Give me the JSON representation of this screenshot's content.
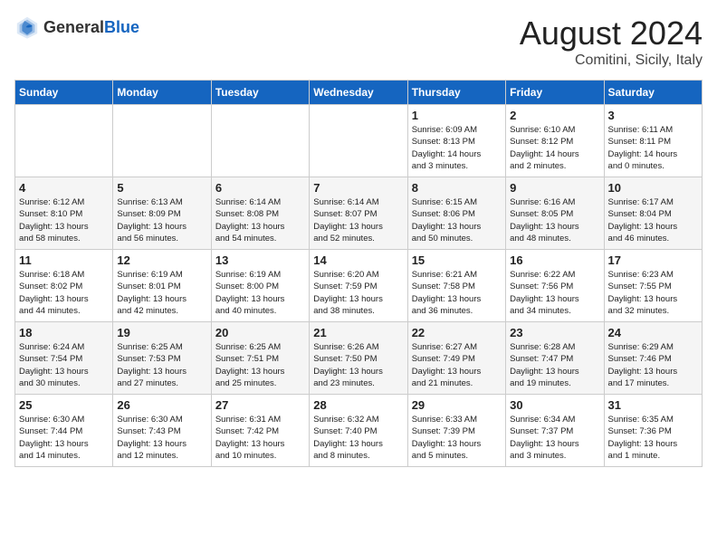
{
  "logo": {
    "general": "General",
    "blue": "Blue"
  },
  "header": {
    "month": "August 2024",
    "location": "Comitini, Sicily, Italy"
  },
  "days_of_week": [
    "Sunday",
    "Monday",
    "Tuesday",
    "Wednesday",
    "Thursday",
    "Friday",
    "Saturday"
  ],
  "weeks": [
    [
      {
        "day": "",
        "info": ""
      },
      {
        "day": "",
        "info": ""
      },
      {
        "day": "",
        "info": ""
      },
      {
        "day": "",
        "info": ""
      },
      {
        "day": "1",
        "info": "Sunrise: 6:09 AM\nSunset: 8:13 PM\nDaylight: 14 hours\nand 3 minutes."
      },
      {
        "day": "2",
        "info": "Sunrise: 6:10 AM\nSunset: 8:12 PM\nDaylight: 14 hours\nand 2 minutes."
      },
      {
        "day": "3",
        "info": "Sunrise: 6:11 AM\nSunset: 8:11 PM\nDaylight: 14 hours\nand 0 minutes."
      }
    ],
    [
      {
        "day": "4",
        "info": "Sunrise: 6:12 AM\nSunset: 8:10 PM\nDaylight: 13 hours\nand 58 minutes."
      },
      {
        "day": "5",
        "info": "Sunrise: 6:13 AM\nSunset: 8:09 PM\nDaylight: 13 hours\nand 56 minutes."
      },
      {
        "day": "6",
        "info": "Sunrise: 6:14 AM\nSunset: 8:08 PM\nDaylight: 13 hours\nand 54 minutes."
      },
      {
        "day": "7",
        "info": "Sunrise: 6:14 AM\nSunset: 8:07 PM\nDaylight: 13 hours\nand 52 minutes."
      },
      {
        "day": "8",
        "info": "Sunrise: 6:15 AM\nSunset: 8:06 PM\nDaylight: 13 hours\nand 50 minutes."
      },
      {
        "day": "9",
        "info": "Sunrise: 6:16 AM\nSunset: 8:05 PM\nDaylight: 13 hours\nand 48 minutes."
      },
      {
        "day": "10",
        "info": "Sunrise: 6:17 AM\nSunset: 8:04 PM\nDaylight: 13 hours\nand 46 minutes."
      }
    ],
    [
      {
        "day": "11",
        "info": "Sunrise: 6:18 AM\nSunset: 8:02 PM\nDaylight: 13 hours\nand 44 minutes."
      },
      {
        "day": "12",
        "info": "Sunrise: 6:19 AM\nSunset: 8:01 PM\nDaylight: 13 hours\nand 42 minutes."
      },
      {
        "day": "13",
        "info": "Sunrise: 6:19 AM\nSunset: 8:00 PM\nDaylight: 13 hours\nand 40 minutes."
      },
      {
        "day": "14",
        "info": "Sunrise: 6:20 AM\nSunset: 7:59 PM\nDaylight: 13 hours\nand 38 minutes."
      },
      {
        "day": "15",
        "info": "Sunrise: 6:21 AM\nSunset: 7:58 PM\nDaylight: 13 hours\nand 36 minutes."
      },
      {
        "day": "16",
        "info": "Sunrise: 6:22 AM\nSunset: 7:56 PM\nDaylight: 13 hours\nand 34 minutes."
      },
      {
        "day": "17",
        "info": "Sunrise: 6:23 AM\nSunset: 7:55 PM\nDaylight: 13 hours\nand 32 minutes."
      }
    ],
    [
      {
        "day": "18",
        "info": "Sunrise: 6:24 AM\nSunset: 7:54 PM\nDaylight: 13 hours\nand 30 minutes."
      },
      {
        "day": "19",
        "info": "Sunrise: 6:25 AM\nSunset: 7:53 PM\nDaylight: 13 hours\nand 27 minutes."
      },
      {
        "day": "20",
        "info": "Sunrise: 6:25 AM\nSunset: 7:51 PM\nDaylight: 13 hours\nand 25 minutes."
      },
      {
        "day": "21",
        "info": "Sunrise: 6:26 AM\nSunset: 7:50 PM\nDaylight: 13 hours\nand 23 minutes."
      },
      {
        "day": "22",
        "info": "Sunrise: 6:27 AM\nSunset: 7:49 PM\nDaylight: 13 hours\nand 21 minutes."
      },
      {
        "day": "23",
        "info": "Sunrise: 6:28 AM\nSunset: 7:47 PM\nDaylight: 13 hours\nand 19 minutes."
      },
      {
        "day": "24",
        "info": "Sunrise: 6:29 AM\nSunset: 7:46 PM\nDaylight: 13 hours\nand 17 minutes."
      }
    ],
    [
      {
        "day": "25",
        "info": "Sunrise: 6:30 AM\nSunset: 7:44 PM\nDaylight: 13 hours\nand 14 minutes."
      },
      {
        "day": "26",
        "info": "Sunrise: 6:30 AM\nSunset: 7:43 PM\nDaylight: 13 hours\nand 12 minutes."
      },
      {
        "day": "27",
        "info": "Sunrise: 6:31 AM\nSunset: 7:42 PM\nDaylight: 13 hours\nand 10 minutes."
      },
      {
        "day": "28",
        "info": "Sunrise: 6:32 AM\nSunset: 7:40 PM\nDaylight: 13 hours\nand 8 minutes."
      },
      {
        "day": "29",
        "info": "Sunrise: 6:33 AM\nSunset: 7:39 PM\nDaylight: 13 hours\nand 5 minutes."
      },
      {
        "day": "30",
        "info": "Sunrise: 6:34 AM\nSunset: 7:37 PM\nDaylight: 13 hours\nand 3 minutes."
      },
      {
        "day": "31",
        "info": "Sunrise: 6:35 AM\nSunset: 7:36 PM\nDaylight: 13 hours\nand 1 minute."
      }
    ]
  ]
}
